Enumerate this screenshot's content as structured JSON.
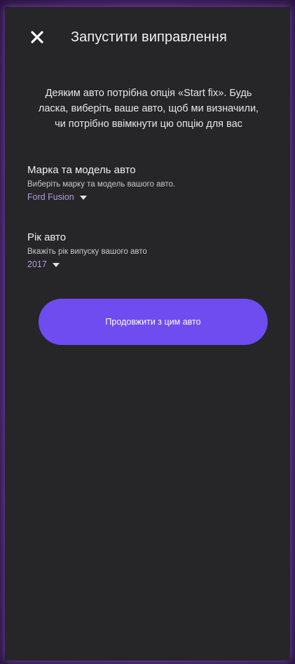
{
  "header": {
    "title": "Запустити виправлення",
    "close_icon": "close-icon"
  },
  "intro": {
    "text": "Деяким авто потрібна опція «Start fix». Будь ласка, виберіть ваше авто, щоб ми визначили, чи потрібно ввімкнути цю опцію для вас"
  },
  "make_model": {
    "label": "Марка та модель авто",
    "hint": "Виберіть марку та модель вашого авто.",
    "value": "Ford Fusion",
    "dropdown_icon": "chevron-down-icon"
  },
  "year": {
    "label": "Рік авто",
    "hint": "Вкажіть рік випуску вашого авто",
    "value": "2017",
    "dropdown_icon": "chevron-down-icon"
  },
  "cta": {
    "label": "Продовжити з цим авто"
  },
  "colors": {
    "background": "#262527",
    "accent": "#6e4cf0",
    "select_value": "#b69be0",
    "glow": "#5a2f86"
  }
}
